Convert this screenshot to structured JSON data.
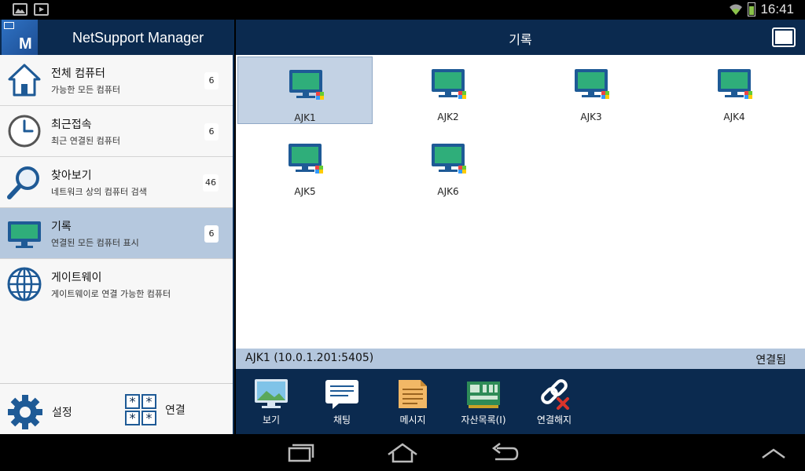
{
  "status_bar": {
    "time": "16:41"
  },
  "app": {
    "title": "NetSupport Manager",
    "logo_letter": "M"
  },
  "sidebar": {
    "items": [
      {
        "title": "전체 컴퓨터",
        "subtitle": "가능한 모든 컴퓨터",
        "count": "6",
        "icon": "home-icon"
      },
      {
        "title": "최근접속",
        "subtitle": "최근 연결된 컴퓨터",
        "count": "6",
        "icon": "clock-icon"
      },
      {
        "title": "찾아보기",
        "subtitle": "네트워크 상의 컴퓨터 검색",
        "count": "46",
        "icon": "search-icon"
      },
      {
        "title": "기록",
        "subtitle": "연결된 모든 컴퓨터 표시",
        "count": "6",
        "icon": "monitor-icon",
        "active": true
      },
      {
        "title": "게이트웨이",
        "subtitle": "게이트웨이로 연결 가능한 컴퓨터",
        "count": "",
        "icon": "globe-icon"
      }
    ],
    "settings_label": "설정",
    "connect_label": "연결"
  },
  "main": {
    "title": "기록",
    "computers": [
      {
        "name": "AJK1",
        "selected": true
      },
      {
        "name": "AJK2"
      },
      {
        "name": "AJK3"
      },
      {
        "name": "AJK4"
      },
      {
        "name": "AJK5"
      },
      {
        "name": "AJK6"
      }
    ],
    "selection": {
      "address": "AJK1 (10.0.1.201:5405)",
      "status": "연결됨"
    },
    "toolbar": {
      "view": "보기",
      "chat": "채팅",
      "message": "메시지",
      "inventory": "자산목록(I)",
      "disconnect": "연결해지"
    }
  },
  "colors": {
    "header_bg": "#0b2a4f",
    "active_item_bg": "#b5c8de",
    "screen_green": "#2fae7a",
    "icon_blue": "#1e5a96"
  }
}
